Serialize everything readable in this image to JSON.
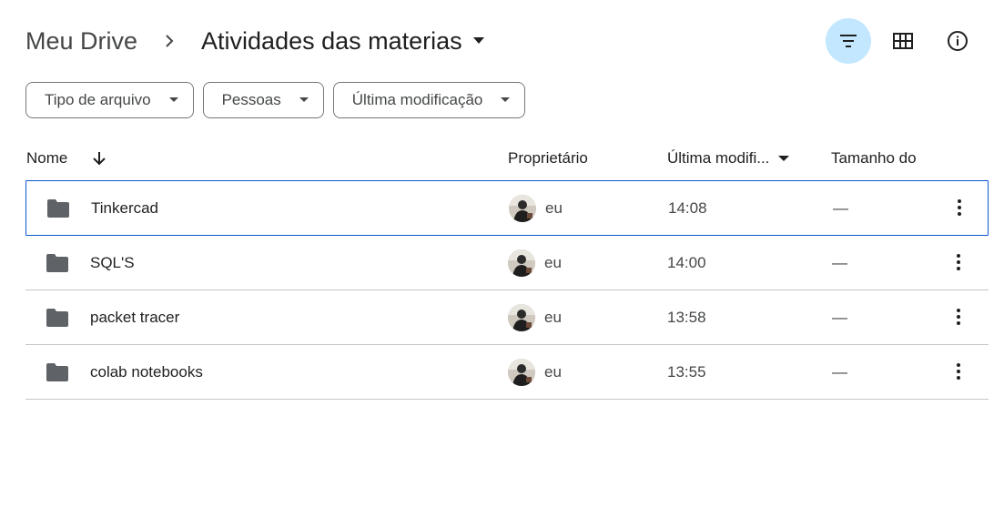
{
  "breadcrumb": {
    "root": "Meu Drive",
    "current": "Atividades das materias"
  },
  "header_actions": {
    "filter_icon": "filter-icon",
    "grid_icon": "grid-view-icon",
    "info_icon": "info-icon"
  },
  "filters": [
    {
      "label": "Tipo de arquivo"
    },
    {
      "label": "Pessoas"
    },
    {
      "label": "Última modificação"
    }
  ],
  "table": {
    "headers": {
      "name": "Nome",
      "owner": "Proprietário",
      "modified": "Última modifi...",
      "size": "Tamanho do"
    },
    "rows": [
      {
        "name": "Tinkercad",
        "owner": "eu",
        "modified": "14:08",
        "size": "—",
        "selected": true
      },
      {
        "name": "SQL'S",
        "owner": "eu",
        "modified": "14:00",
        "size": "—",
        "selected": false
      },
      {
        "name": "packet tracer",
        "owner": "eu",
        "modified": "13:58",
        "size": "—",
        "selected": false
      },
      {
        "name": "colab notebooks",
        "owner": "eu",
        "modified": "13:55",
        "size": "—",
        "selected": false
      }
    ]
  },
  "colors": {
    "accent_bg": "#c2e7ff",
    "selection_border": "#0b57d0",
    "folder": "#5f6368"
  }
}
